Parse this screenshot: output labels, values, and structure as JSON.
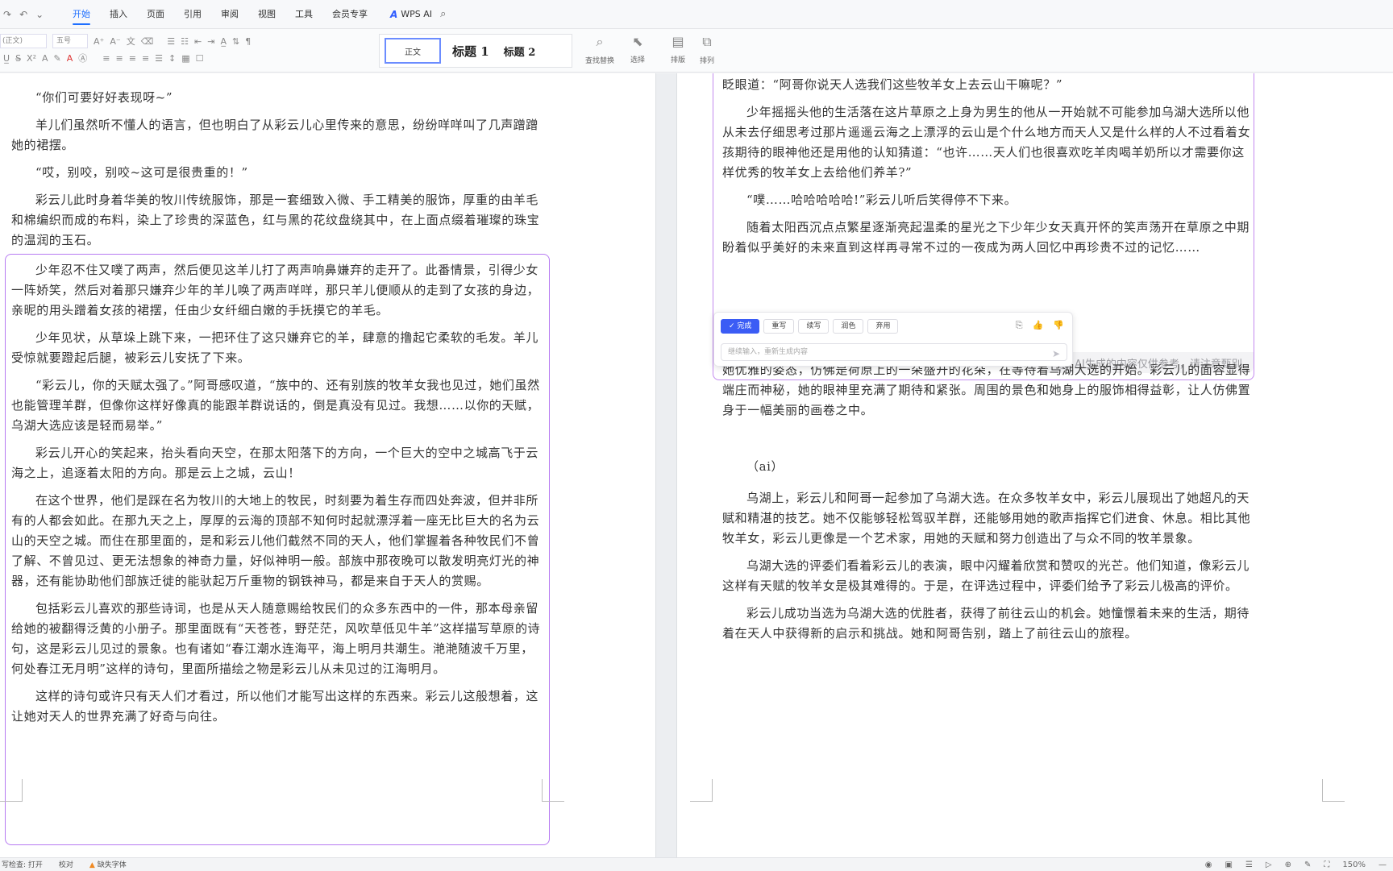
{
  "menu": {
    "tabs": [
      "开始",
      "插入",
      "页面",
      "引用",
      "审阅",
      "视图",
      "工具",
      "会员专享"
    ],
    "active_tab": "开始",
    "wps_ai": "WPS AI"
  },
  "ribbon": {
    "font_name": "(正文)",
    "font_size": "五号",
    "style_normal": "正文",
    "style_h1": "标题 1",
    "style_h2": "标题 2",
    "find_replace": "查找替换",
    "select": "选择",
    "layout": "排版",
    "arrange": "排列"
  },
  "left_page": {
    "paragraphs": [
      "“你们可要好好表现呀~”",
      "羊儿们虽然听不懂人的语言，但也明白了从彩云儿心里传来的意思，纷纷咩咩叫了几声蹭蹭她的裙摆。",
      "“哎，别咬，别咬~这可是很贵重的！”",
      "彩云儿此时身着华美的牧川传统服饰，那是一套细致入微、手工精美的服饰，厚重的由羊毛和棉编织而成的布料，染上了珍贵的深蓝色，红与黑的花纹盘绕其中，在上面点缀着璀璨的珠宝的温润的玉石。"
    ],
    "box_paragraphs": [
      "少年忍不住又噗了两声，然后便见这羊儿打了两声响鼻嫌弃的走开了。此番情景，引得少女一阵娇笑，然后对着那只嫌弃少年的羊儿唤了两声咩咩，那只羊儿便顺从的走到了女孩的身边，亲昵的用头蹭着女孩的裙摆，任由少女纤细白嫩的手抚摸它的羊毛。",
      "少年见状，从草垛上跳下来，一把环住了这只嫌弃它的羊，肆意的撸起它柔软的毛发。羊儿受惊就要蹬起后腿，被彩云儿安抚了下来。",
      "“彩云儿，你的天赋太强了。”阿哥感叹道，“族中的、还有别族的牧羊女我也见过，她们虽然也能管理羊群，但像你这样好像真的能跟羊群说话的，倒是真没有见过。我想……以你的天赋，乌湖大选应该是轻而易举。”",
      "彩云儿开心的笑起来，抬头看向天空，在那太阳落下的方向，一个巨大的空中之城高飞于云海之上，追逐着太阳的方向。那是云上之城，云山！",
      "在这个世界，他们是踩在名为牧川的大地上的牧民，时刻要为着生存而四处奔波，但并非所有的人都会如此。在那九天之上，厚厚的云海的顶部不知何时起就漂浮着一座无比巨大的名为云山的天空之城。而住在那里面的，是和彩云儿他们截然不同的天人，他们掌握着各种牧民们不曾了解、不曾见过、更无法想象的神奇力量，好似神明一般。部族中那夜晚可以散发明亮灯光的神器，还有能协助他们部族迁徙的能驮起万斤重物的钢铁神马，都是来自于天人的赏赐。",
      "包括彩云儿喜欢的那些诗词，也是从天人随意赐给牧民们的众多东西中的一件，那本母亲留给她的被翻得泛黄的小册子。那里面既有“天苍苍，野茫茫，风吹草低见牛羊”这样描写草原的诗句，这是彩云儿见过的景象。也有诸如“春江潮水连海平，海上明月共潮生。滟滟随波千万里，何处春江无月明”这样的诗句，里面所描绘之物是彩云儿从未见过的江海明月。",
      "这样的诗句或许只有天人们才看过，所以他们才能写出这样的东西来。彩云儿这般想着，这让她对天人的世界充满了好奇与向往。"
    ]
  },
  "right_page": {
    "box_paragraphs": [
      "眨眼道：“阿哥你说天人选我们这些牧羊女上去云山干嘛呢？”",
      "少年摇摇头他的生活落在这片草原之上身为男生的他从一开始就不可能参加乌湖大选所以他从未去仔细思考过那片遥遥云海之上漂浮的云山是个什么地方而天人又是什么样的人不过看着女孩期待的眼神他还是用他的认知猜道：“也许……天人们也很喜欢吃羊肉喝羊奶所以才需要你这样优秀的牧羊女上去给他们养羊?”",
      "“噗……哈哈哈哈哈!”彩云儿听后笑得停不下来。",
      "随着太阳西沉点点繁星逐渐亮起温柔的星光之下少年少女天真开怀的笑声荡开在草原之中期盼着似乎美好的未来直到这样再寻常不过的一夜成为两人回忆中再珍贵不过的记忆……"
    ],
    "ai_note": "AI生成的内容仅供参考，请注意甄别",
    "ai_actions": [
      "完成",
      "重写",
      "续写",
      "润色",
      "弃用"
    ],
    "ai_input_placeholder": "继续输入，重新生成内容",
    "para_after_panel": [
      "她优雅的姿态，仿佛是荷原上的一朵盛开的花朵，在等待着乌湖大选的开始。彩云儿的面容显得端庄而神秘，她的眼神里充满了期待和紧张。周围的景色和她身上的服饰相得益彰，让人仿佛置身于一幅美丽的画卷之中。"
    ],
    "ai_heading": "（ai）",
    "ai_paragraphs": [
      "乌湖上，彩云儿和阿哥一起参加了乌湖大选。在众多牧羊女中，彩云儿展现出了她超凡的天赋和精湛的技艺。她不仅能够轻松驾驭羊群，还能够用她的歌声指挥它们进食、休息。相比其他牧羊女，彩云儿更像是一个艺术家，用她的天赋和努力创造出了与众不同的牧羊景象。",
      "乌湖大选的评委们看着彩云儿的表演，眼中闪耀着欣赏和赞叹的光芒。他们知道，像彩云儿这样有天赋的牧羊女是极其难得的。于是，在评选过程中，评委们给予了彩云儿极高的评价。",
      "彩云儿成功当选为乌湖大选的优胜者，获得了前往云山的机会。她憧憬着未来的生活，期待着在天人中获得新的启示和挑战。她和阿哥告别，踏上了前往云山的旅程。"
    ]
  },
  "status": {
    "spellcheck": "写检查: 打开",
    "proofread": "校对",
    "missing_font": "缺失字体",
    "zoom": "150%"
  },
  "colors": {
    "accent": "#1f6fff",
    "ai_border": "#b77bf2",
    "ai_button": "#3b5cf5"
  }
}
